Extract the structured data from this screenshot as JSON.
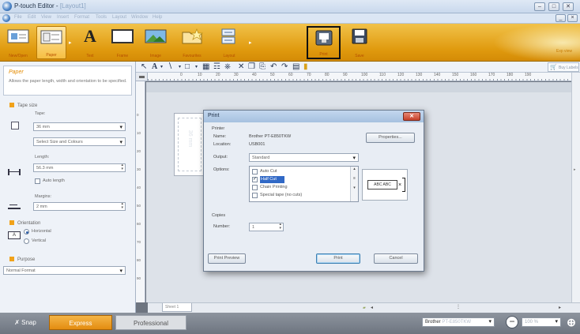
{
  "window": {
    "title": "P-touch Editor - ",
    "title_suffix": "[Layout1]",
    "buttons": [
      "–",
      "□",
      "✕"
    ],
    "mdi_buttons": [
      "_",
      "×"
    ]
  },
  "menubar": {
    "items": [
      "File",
      "Edit",
      "View",
      "Insert",
      "Format",
      "Tools",
      "Layout",
      "Window",
      "Help"
    ]
  },
  "ribbon": {
    "buttons": [
      {
        "label": "New/Open"
      },
      {
        "label": "Paper"
      },
      {
        "label": "Text"
      },
      {
        "label": "Frame"
      },
      {
        "label": "Image"
      },
      {
        "label": "Favourites"
      },
      {
        "label": "Layout"
      },
      {
        "label": "Print"
      },
      {
        "label": "Save"
      }
    ],
    "right_hint": "Exp view"
  },
  "left_panel": {
    "tip_title": "Paper",
    "tip_text": "Allows the paper length, width and orientation to be specified.",
    "tape_size": {
      "heading": "Tape size",
      "tape_label": "Tape:",
      "tape_value": "36 mm",
      "select_button": "Select Size and Colours",
      "length_label": "Length:",
      "length_value": "56.3 mm",
      "auto_length": "Auto length",
      "margins_label": "Margins:",
      "margins_value": "2 mm"
    },
    "orientation": {
      "heading": "Orientation",
      "horizontal": "Horizontal",
      "vertical": "Vertical"
    },
    "purpose": {
      "heading": "Purpose",
      "value": "Normal Format"
    }
  },
  "toolbar2": {
    "buy_labels": "Buy Labels"
  },
  "ruler": {
    "h_marks": [
      "0",
      "10",
      "20",
      "30",
      "40",
      "50",
      "60",
      "70",
      "80",
      "90",
      "100",
      "110",
      "120",
      "130",
      "140",
      "150",
      "160",
      "170",
      "180",
      "190"
    ],
    "v_marks": [
      "0",
      "10",
      "20",
      "30",
      "40",
      "50",
      "60",
      "70",
      "80",
      "90"
    ]
  },
  "canvas": {
    "paper_text": "36 mm",
    "sheet_tab": "Sheet 1"
  },
  "statusbar": {
    "snap": "Snap",
    "express": "Express",
    "professional": "Professional",
    "printer": "Brother",
    "printer_suffix": "PT-E850TKW",
    "zoom": "100 %"
  },
  "print_dialog": {
    "title": "Print",
    "printer_group": "Printer",
    "name_label": "Name:",
    "name_value": "Brother PT-E850TKW",
    "location_label": "Location:",
    "location_value": "USB001",
    "properties_button": "Properties...",
    "output_label": "Output:",
    "output_value": "Standard",
    "options_label": "Options:",
    "options": [
      {
        "label": "Auto Cut",
        "checked": false,
        "highlighted": false
      },
      {
        "label": "Half Cut",
        "checked": true,
        "highlighted": true
      },
      {
        "label": "Chain Printing",
        "checked": false,
        "highlighted": false
      },
      {
        "label": "Special tape (no cuts)",
        "checked": false,
        "highlighted": false
      }
    ],
    "preview_text": "ABC ABC",
    "copies_group": "Copies",
    "number_label": "Number:",
    "number_value": "1",
    "print_preview_button": "Print Preview",
    "print_button": "Print",
    "cancel_button": "Cancel"
  },
  "colors": {
    "ribbon_orange": "#e09a0e",
    "express_orange": "#e8961c",
    "selection_blue": "#3169c6"
  }
}
